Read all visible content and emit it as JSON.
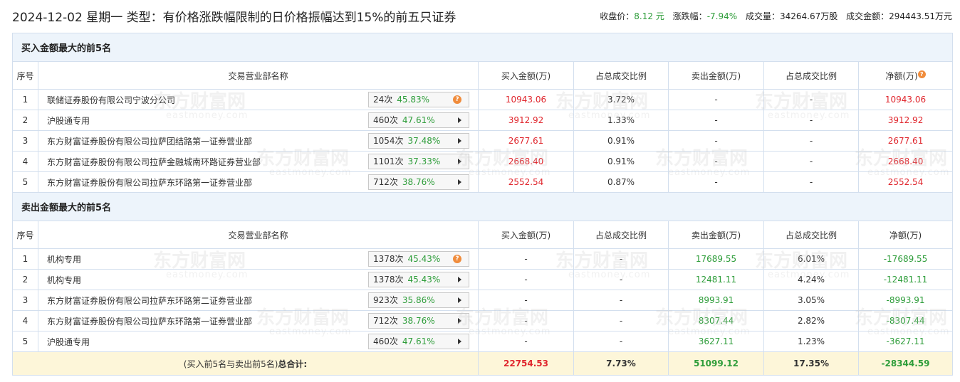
{
  "header": {
    "title": "2024-12-02 星期一 类型：有价格涨跌幅限制的日价格振幅达到15%的前五只证券",
    "close_label": "收盘价：",
    "close_value": "8.12 元",
    "change_label": "涨跌幅：",
    "change_value": "-7.94%",
    "volume_label": "成交量：",
    "volume_value": "34264.67万股",
    "turnover_label": "成交金额：",
    "turnover_value": "294443.51万元"
  },
  "columns": {
    "seq": "序号",
    "name": "交易营业部名称",
    "buy": "买入金额(万)",
    "buy_ratio": "占总成交比例",
    "sell": "卖出金额(万)",
    "sell_ratio": "占总成交比例",
    "net": "净额(万)"
  },
  "help_icon": "?",
  "watermark": {
    "cn": "东方财富网",
    "en": "eastmoney.com"
  },
  "buy_section": {
    "title": "买入金额最大的前5名",
    "rows": [
      {
        "seq": "1",
        "name": "联储证券股份有限公司宁波分公司",
        "times": "24次",
        "pct": "45.83%",
        "icon": "help",
        "buy": "10943.06",
        "buy_ratio": "3.72%",
        "sell": "-",
        "sell_ratio": "-",
        "net": "10943.06"
      },
      {
        "seq": "2",
        "name": "沪股通专用",
        "times": "460次",
        "pct": "47.61%",
        "icon": "arrow",
        "buy": "3912.92",
        "buy_ratio": "1.33%",
        "sell": "-",
        "sell_ratio": "-",
        "net": "3912.92"
      },
      {
        "seq": "3",
        "name": "东方财富证券股份有限公司拉萨团结路第一证券营业部",
        "times": "1054次",
        "pct": "37.48%",
        "icon": "arrow",
        "buy": "2677.61",
        "buy_ratio": "0.91%",
        "sell": "-",
        "sell_ratio": "-",
        "net": "2677.61"
      },
      {
        "seq": "4",
        "name": "东方财富证券股份有限公司拉萨金融城南环路证券营业部",
        "times": "1101次",
        "pct": "37.33%",
        "icon": "arrow",
        "buy": "2668.40",
        "buy_ratio": "0.91%",
        "sell": "-",
        "sell_ratio": "-",
        "net": "2668.40"
      },
      {
        "seq": "5",
        "name": "东方财富证券股份有限公司拉萨东环路第一证券营业部",
        "times": "712次",
        "pct": "38.76%",
        "icon": "arrow",
        "buy": "2552.54",
        "buy_ratio": "0.87%",
        "sell": "-",
        "sell_ratio": "-",
        "net": "2552.54"
      }
    ]
  },
  "sell_section": {
    "title": "卖出金额最大的前5名",
    "rows": [
      {
        "seq": "1",
        "name": "机构专用",
        "times": "1378次",
        "pct": "45.43%",
        "icon": "help",
        "buy": "-",
        "buy_ratio": "-",
        "sell": "17689.55",
        "sell_ratio": "6.01%",
        "net": "-17689.55"
      },
      {
        "seq": "2",
        "name": "机构专用",
        "times": "1378次",
        "pct": "45.43%",
        "icon": "arrow",
        "buy": "-",
        "buy_ratio": "-",
        "sell": "12481.11",
        "sell_ratio": "4.24%",
        "net": "-12481.11"
      },
      {
        "seq": "3",
        "name": "东方财富证券股份有限公司拉萨东环路第二证券营业部",
        "times": "923次",
        "pct": "35.86%",
        "icon": "arrow",
        "buy": "-",
        "buy_ratio": "-",
        "sell": "8993.91",
        "sell_ratio": "3.05%",
        "net": "-8993.91"
      },
      {
        "seq": "4",
        "name": "东方财富证券股份有限公司拉萨东环路第一证券营业部",
        "times": "712次",
        "pct": "38.76%",
        "icon": "arrow",
        "buy": "-",
        "buy_ratio": "-",
        "sell": "8307.44",
        "sell_ratio": "2.82%",
        "net": "-8307.44"
      },
      {
        "seq": "5",
        "name": "沪股通专用",
        "times": "460次",
        "pct": "47.61%",
        "icon": "arrow",
        "buy": "-",
        "buy_ratio": "-",
        "sell": "3627.11",
        "sell_ratio": "1.23%",
        "net": "-3627.11"
      }
    ]
  },
  "total": {
    "label_prefix": "(买入前5名与卖出前5名)",
    "label_bold": "总合计:",
    "buy": "22754.53",
    "buy_ratio": "7.73%",
    "sell": "51099.12",
    "sell_ratio": "17.35%",
    "net": "-28344.59"
  },
  "colors": {
    "up": "#e0262d",
    "down": "#2e9d3a",
    "section_bg": "#edf4fb",
    "total_bg": "#fdf6d9",
    "border": "#d3dfee"
  }
}
